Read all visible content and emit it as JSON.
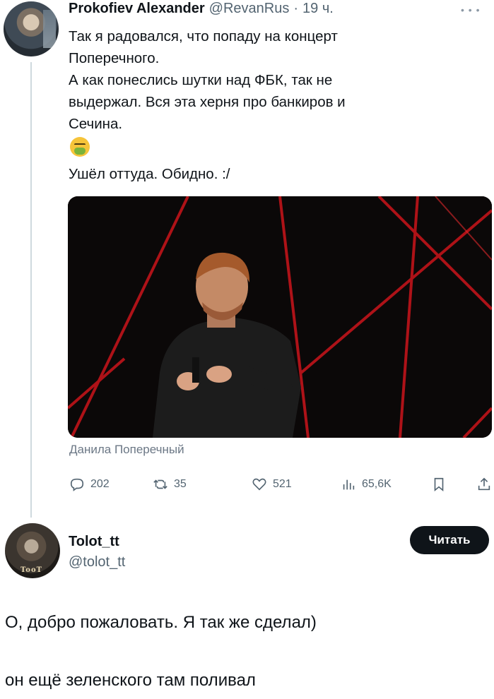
{
  "tweet": {
    "author_name": "Prokofiev Alexander",
    "author_handle": "@RevanRus",
    "separator": "·",
    "time": "19 ч.",
    "more_icon": "more-horizontal-icon",
    "lines": [
      "Так я радовался, что попаду на концерт",
      "Поперечного.",
      "А как понеслись шутки над ФБК, так не",
      "выдержал. Вся эта херня про банкиров и",
      "Сечина."
    ],
    "emoji": "nauseated-face-icon",
    "last_line": "Ушёл оттуда. Обидно. :/",
    "media_caption": "Данила Поперечный",
    "stats": {
      "replies": "202",
      "retweets": "35",
      "likes": "521",
      "views": "65,6K"
    }
  },
  "reply_user": {
    "name": "Tolot_tt",
    "handle": "@tolot_tt",
    "avatar_badge": "TooT",
    "follow_label": "Читать"
  },
  "comments": [
    "О, добро пожаловать. Я так же сделал)",
    "он ещё зеленского там поливал"
  ],
  "colors": {
    "text": "#0f1419",
    "secondary": "#536471",
    "thread_line": "#cfd9de",
    "button_bg": "#0f1419",
    "stage_laser": "#c0141a"
  }
}
